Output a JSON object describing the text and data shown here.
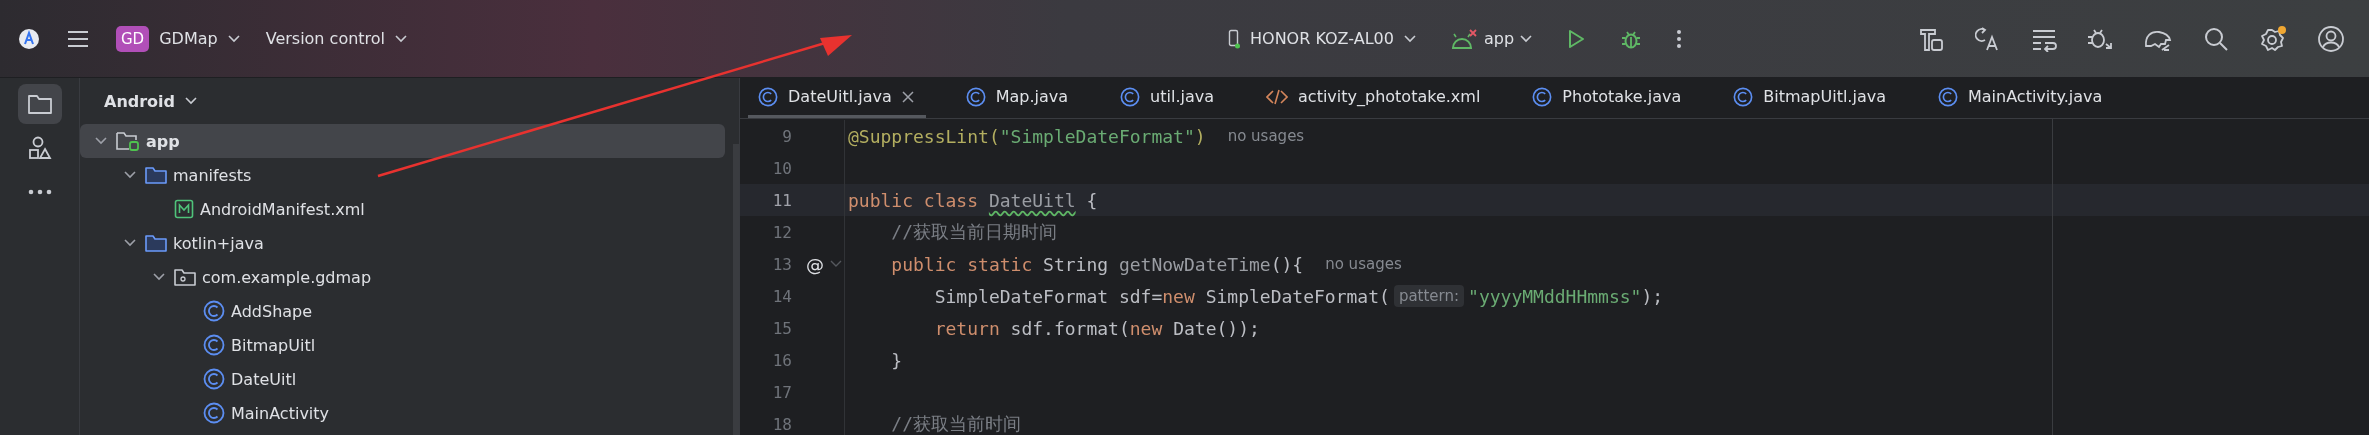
{
  "toolbar": {
    "project_badge": "GD",
    "project": "GDMap",
    "vcs": "Version control",
    "device": "HONOR KOZ-AL00",
    "run_config": "app"
  },
  "sidebar": {
    "items": [
      {
        "kind": "project",
        "selected": true
      },
      {
        "kind": "structure",
        "selected": false
      },
      {
        "kind": "more",
        "selected": false
      }
    ]
  },
  "project_panel": {
    "view": "Android",
    "tree": [
      {
        "label": "app",
        "kind": "module",
        "selected": true,
        "expanded": true,
        "children": [
          {
            "label": "manifests",
            "kind": "folder",
            "selected": false,
            "expanded": true,
            "children": [
              {
                "label": "AndroidManifest.xml",
                "kind": "manifest",
                "selected": false
              }
            ]
          },
          {
            "label": "kotlin+java",
            "kind": "folder",
            "selected": false,
            "expanded": true,
            "children": [
              {
                "label": "com.example.gdmap",
                "kind": "package",
                "selected": false,
                "expanded": true,
                "children": [
                  {
                    "label": "AddShape",
                    "kind": "class",
                    "selected": false
                  },
                  {
                    "label": "BitmapUitl",
                    "kind": "class",
                    "selected": false
                  },
                  {
                    "label": "DateUitl",
                    "kind": "class",
                    "selected": false
                  },
                  {
                    "label": "MainActivity",
                    "kind": "class",
                    "selected": false
                  }
                ]
              }
            ]
          }
        ]
      }
    ]
  },
  "tabs": [
    {
      "label": "DateUitl.java",
      "kind": "class",
      "selected": true
    },
    {
      "label": "Map.java",
      "kind": "class",
      "selected": false
    },
    {
      "label": "util.java",
      "kind": "class",
      "selected": false
    },
    {
      "label": "activity_phototake.xml",
      "kind": "xml",
      "selected": false
    },
    {
      "label": "Phototake.java",
      "kind": "class",
      "selected": false
    },
    {
      "label": "BitmapUitl.java",
      "kind": "class",
      "selected": false
    },
    {
      "label": "MainActivity.java",
      "kind": "class",
      "selected": false
    }
  ],
  "editor": {
    "lines": [
      {
        "number": "9",
        "current": false,
        "tokens": [
          {
            "t": "@SuppressLint(",
            "kind": "annotation"
          },
          {
            "t": "\"SimpleDateFormat\"",
            "kind": "string"
          },
          {
            "t": ")",
            "kind": "annotation"
          },
          {
            "t": "no usages",
            "kind": "hint"
          }
        ]
      },
      {
        "number": "10",
        "current": false
      },
      {
        "number": "11",
        "current": true,
        "tokens": [
          {
            "t": "public class ",
            "kind": "keyword"
          },
          {
            "t": "DateUitl",
            "kind": "typo"
          },
          {
            "t": " {",
            "kind": "plain"
          }
        ]
      },
      {
        "number": "12",
        "current": false,
        "tokens": [
          {
            "t": "    //获取当前日期时间",
            "kind": "comment"
          }
        ]
      },
      {
        "number": "13",
        "current": false,
        "gutter": "@",
        "tokens": [
          {
            "t": "    public static ",
            "kind": "keyword"
          },
          {
            "t": "String ",
            "kind": "plain"
          },
          {
            "t": "getNowDateTime",
            "kind": "unused"
          },
          {
            "t": "(){",
            "kind": "plain"
          },
          {
            "t": "no usages",
            "kind": "hint"
          }
        ]
      },
      {
        "number": "14",
        "current": false,
        "tokens": [
          {
            "t": "        SimpleDateFormat sdf=",
            "kind": "plain"
          },
          {
            "t": "new ",
            "kind": "keyword"
          },
          {
            "t": "SimpleDateFormat(",
            "kind": "plain"
          },
          {
            "t": "pattern:",
            "kind": "inlay"
          },
          {
            "t": "\"yyyyMMddHHmmss\"",
            "kind": "string"
          },
          {
            "t": ");",
            "kind": "plain"
          }
        ]
      },
      {
        "number": "15",
        "current": false,
        "tokens": [
          {
            "t": "        return ",
            "kind": "keyword"
          },
          {
            "t": "sdf.format(",
            "kind": "plain"
          },
          {
            "t": "new ",
            "kind": "keyword"
          },
          {
            "t": "Date());",
            "kind": "plain"
          }
        ]
      },
      {
        "number": "16",
        "current": false,
        "tokens": [
          {
            "t": "    }",
            "kind": "plain"
          }
        ]
      },
      {
        "number": "17",
        "current": false
      },
      {
        "number": "18",
        "current": false,
        "tokens": [
          {
            "t": "    //获取当前时间",
            "kind": "comment"
          }
        ]
      }
    ]
  }
}
